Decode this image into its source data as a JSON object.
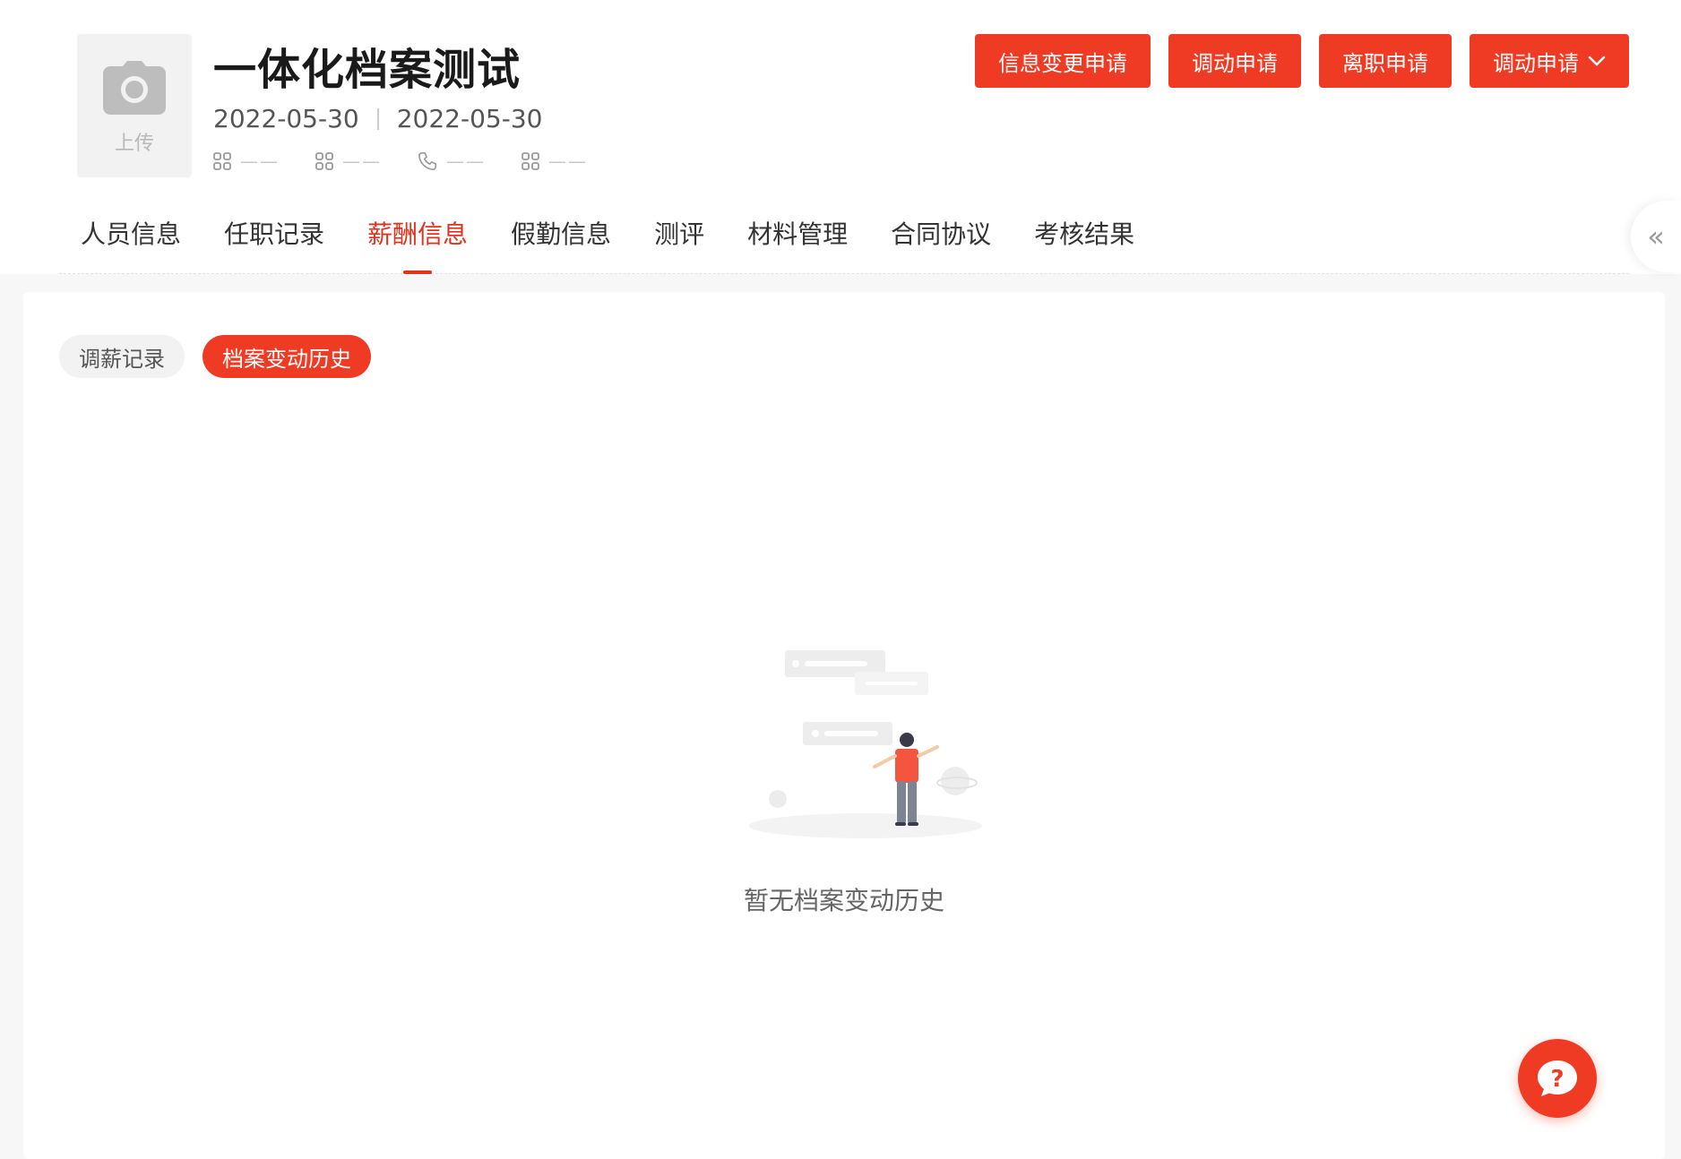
{
  "profile": {
    "avatar_label": "上传",
    "name": "一体化档案测试",
    "date_start": "2022-05-30",
    "date_end": "2022-05-30",
    "meta": [
      {
        "icon": "grid-icon",
        "value": "——"
      },
      {
        "icon": "grid-icon",
        "value": "——"
      },
      {
        "icon": "phone-icon",
        "value": "——"
      },
      {
        "icon": "grid-icon",
        "value": "——"
      }
    ]
  },
  "actions": {
    "info_change": "信息变更申请",
    "transfer": "调动申请",
    "resign": "离职申请",
    "transfer_dropdown": "调动申请"
  },
  "tabs": [
    {
      "label": "人员信息",
      "active": false
    },
    {
      "label": "任职记录",
      "active": false
    },
    {
      "label": "薪酬信息",
      "active": true
    },
    {
      "label": "假勤信息",
      "active": false
    },
    {
      "label": "测评",
      "active": false
    },
    {
      "label": "材料管理",
      "active": false
    },
    {
      "label": "合同协议",
      "active": false
    },
    {
      "label": "考核结果",
      "active": false
    }
  ],
  "subtabs": [
    {
      "label": "调薪记录",
      "active": false
    },
    {
      "label": "档案变动历史",
      "active": true
    }
  ],
  "empty": {
    "message": "暂无档案变动历史"
  },
  "colors": {
    "accent": "#f03b24",
    "accent_text": "#e0321d"
  }
}
